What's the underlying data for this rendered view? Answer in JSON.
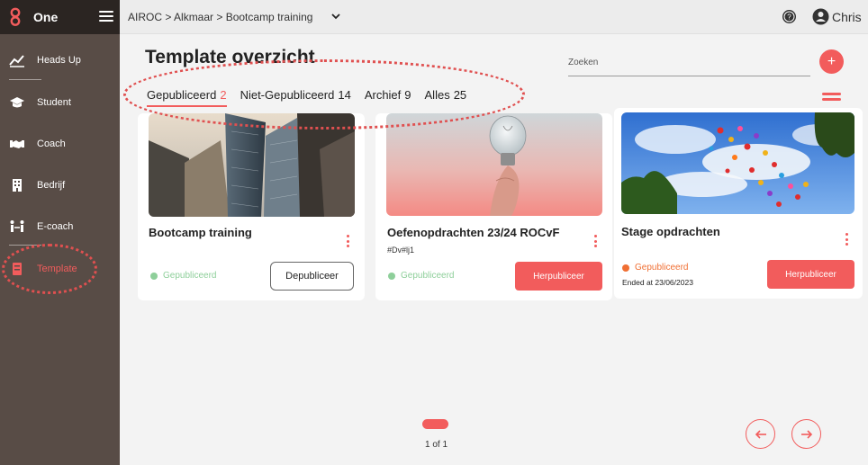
{
  "app": {
    "name": "One"
  },
  "sidebar": {
    "items": [
      {
        "label": "Heads Up",
        "icon": "chart-line-icon"
      },
      {
        "label": "Student",
        "icon": "graduation-cap-icon"
      },
      {
        "label": "Coach",
        "icon": "handshake-icon"
      },
      {
        "label": "Bedrijf",
        "icon": "building-icon"
      },
      {
        "label": "E-coach",
        "icon": "people-arrows-icon"
      },
      {
        "label": "Template",
        "icon": "template-icon",
        "active": true
      }
    ]
  },
  "header": {
    "breadcrumb": "AIROC > Alkmaar > Bootcamp training",
    "user_name": "Chris"
  },
  "main": {
    "title": "Template overzicht",
    "search_placeholder": "Zoeken",
    "add_label": "+",
    "tabs": [
      {
        "label": "Gepubliceerd",
        "count": "2",
        "active": true
      },
      {
        "label": "Niet-Gepubliceerd",
        "count": "14"
      },
      {
        "label": "Archief",
        "count": "9"
      },
      {
        "label": "Alles",
        "count": "25"
      }
    ],
    "cards": [
      {
        "title": "Bootcamp training",
        "tag": "",
        "status": "Gepubliceerd",
        "status_color": "green",
        "ended": "",
        "button": "Depubliceer",
        "button_style": "outline",
        "image": "skyscrapers"
      },
      {
        "title": "Oefenopdrachten 23/24 ROCvF",
        "tag": "#Dv#lj1",
        "status": "Gepubliceerd",
        "status_color": "green",
        "ended": "",
        "button": "Herpubliceer",
        "button_style": "red",
        "image": "lightbulb"
      },
      {
        "title": "Stage opdrachten",
        "tag": "",
        "status": "Gepubliceerd",
        "status_color": "orange",
        "ended": "Ended at 23/06/2023",
        "button": "Herpubliceer",
        "button_style": "red",
        "image": "balloons"
      }
    ],
    "pagination": {
      "label": "1 of 1"
    }
  },
  "colors": {
    "accent": "#f25c5c",
    "sidebar": "#584c46",
    "brand_bar": "#2b2522",
    "published_green": "#8ecf9a",
    "ended_orange": "#f06f33"
  }
}
